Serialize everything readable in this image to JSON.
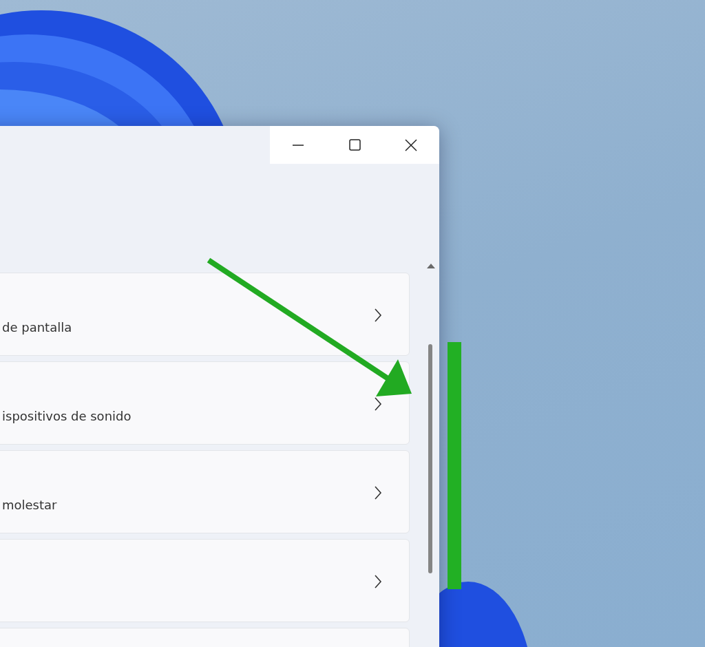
{
  "window": {
    "controls": [
      {
        "kind": "minimize"
      },
      {
        "kind": "maximize"
      },
      {
        "kind": "close"
      }
    ]
  },
  "cards": [
    {
      "kind": "labeled",
      "description": "de pantalla"
    },
    {
      "kind": "labeled",
      "description": "ispositivos de sonido"
    },
    {
      "kind": "labeled",
      "description": "molestar"
    },
    {
      "kind": "blank"
    },
    {
      "kind": "partial"
    }
  ]
}
